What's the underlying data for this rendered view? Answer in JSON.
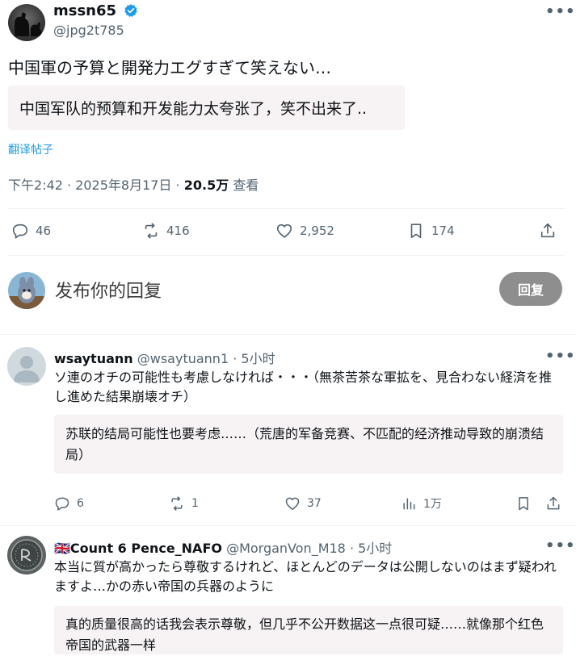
{
  "post": {
    "author_name": "mssn65",
    "author_handle": "@jpg2t785",
    "more": "•••",
    "text": "中国軍の予算と開発力エグすぎて笑えない…",
    "translation": "中国军队的预算和开发能力太夸张了，笑不出来了..",
    "translate_link": "翻译帖子",
    "time": "下午2:42 · 2025年8月17日 · ",
    "views": "20.5万",
    "views_suffix": " 查看",
    "stats": {
      "replies": "46",
      "reposts": "416",
      "likes": "2,952",
      "bookmarks": "174"
    }
  },
  "composer": {
    "placeholder": "发布你的回复",
    "button": "回复"
  },
  "comments": [
    {
      "name": "wsaytuann",
      "meta": "@wsaytuann1 · 5小时",
      "text": "ソ連のオチの可能性も考慮しなければ・・・（無茶苦茶な軍拡を、見合わない経済を推し進めた結果崩壊オチ）",
      "translation": "苏联的结局可能性也要考虑……（荒唐的军备竞赛、不匹配的经济推动导致的崩溃结局）",
      "stats": {
        "replies": "6",
        "reposts": "1",
        "likes": "37",
        "views": "1万"
      }
    },
    {
      "flag": "🇬🇧",
      "name": "Count 6 Pence_NAFO",
      "meta": "@MorganVon_M18 · 5小时",
      "text": "本当に質が高かったら尊敬するけれど、ほとんどのデータは公開しないのはまず疑われますよ…かの赤い帝国の兵器のように",
      "translation": "真的质量很高的话我会表示尊敬，但几乎不公开数据这一点很可疑……就像那个红色帝国的武器一样"
    }
  ],
  "colors": {
    "accent": "#1d9bf0",
    "muted": "#536471",
    "text": "#0f1419",
    "translation_bg": "#f7f2f3",
    "reply_button": "#8e8e8e"
  }
}
